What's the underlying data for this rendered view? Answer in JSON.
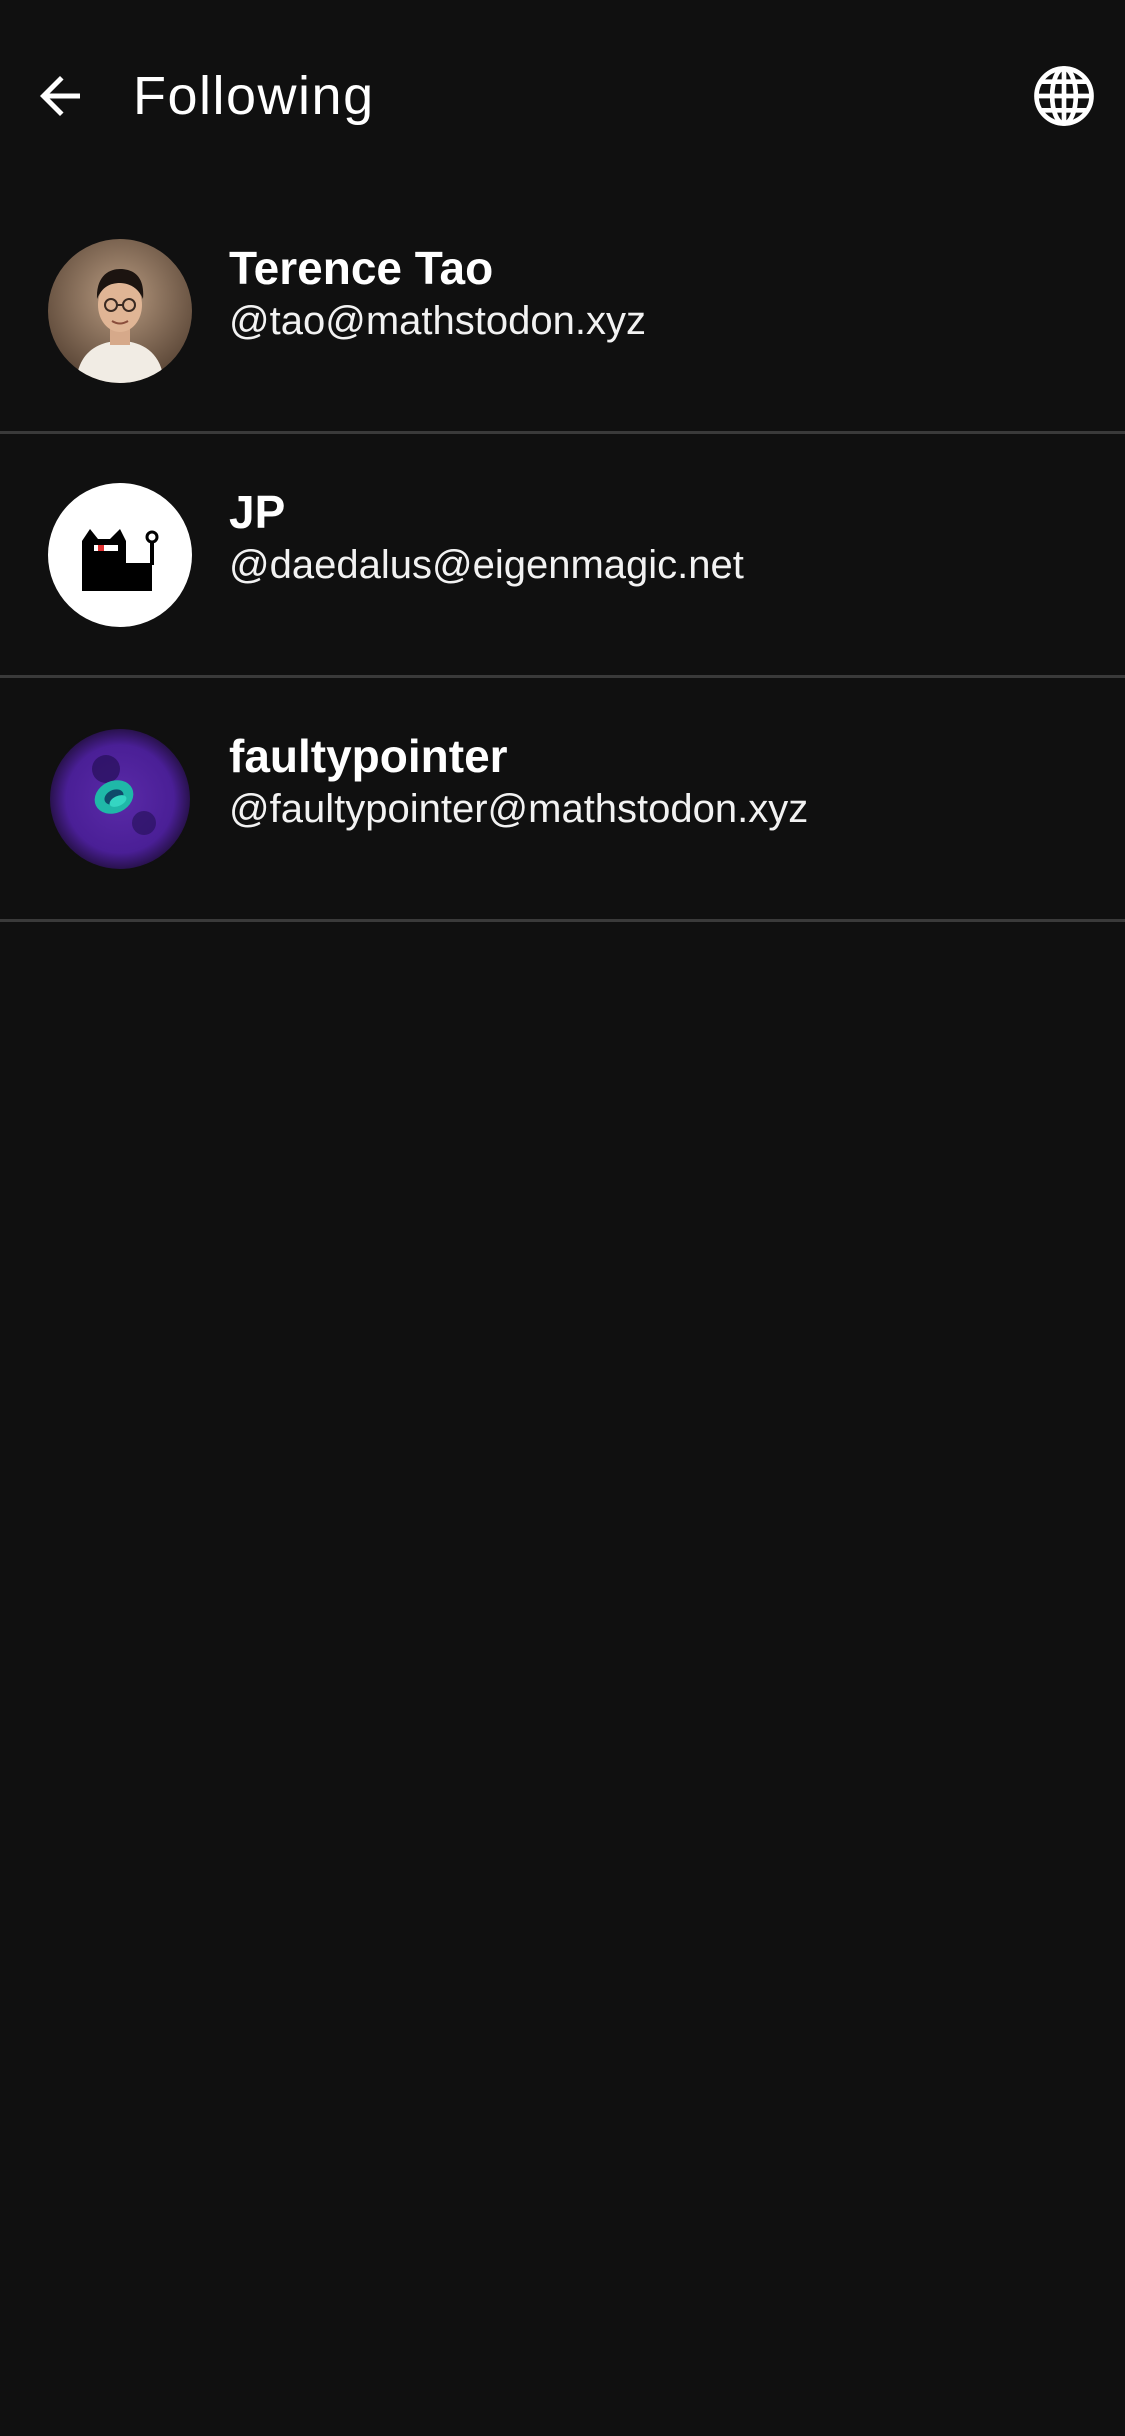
{
  "app_bar": {
    "title": "Following",
    "back_icon": "arrow-left-icon",
    "globe_icon": "globe-icon"
  },
  "accounts": [
    {
      "display_name": "Terence Tao",
      "handle": "@tao@mathstodon.xyz"
    },
    {
      "display_name": "JP",
      "handle": "@daedalus@eigenmagic.net"
    },
    {
      "display_name": "faultypointer",
      "handle": "@faultypointer@mathstodon.xyz"
    }
  ],
  "colors": {
    "background": "#101010",
    "divider": "#3a3a3a",
    "text_primary": "#ffffff"
  }
}
